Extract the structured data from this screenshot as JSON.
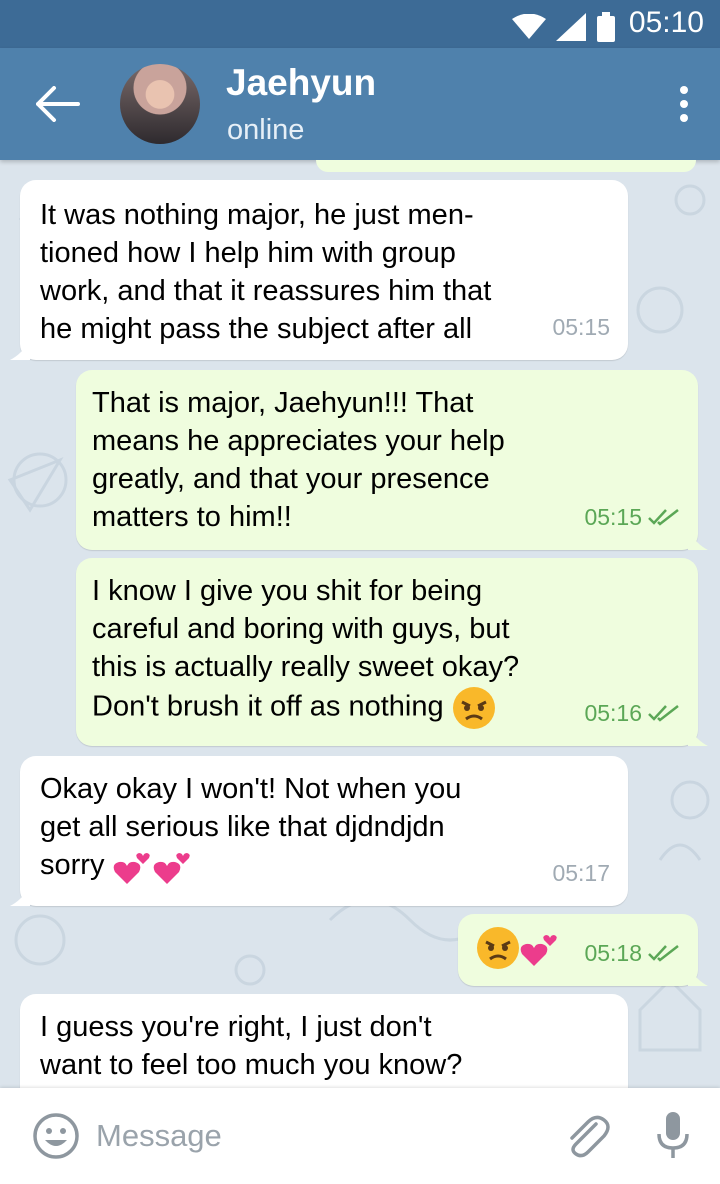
{
  "status_bar": {
    "time": "05:10"
  },
  "header": {
    "back_icon": "arrow-left-icon",
    "title": "Jaehyun",
    "status": "online",
    "menu_icon": "more-vert-icon"
  },
  "messages": [
    {
      "direction": "in",
      "text": "It was nothing major, he just men-\ntioned how I help him with group\nwork, and that it reassures him that\nhe might pass the subject after all",
      "time": "05:15"
    },
    {
      "direction": "out",
      "text": "That is major, Jaehyun!!! That\nmeans he appreciates your help\ngreatly, and that your presence\nmatters to him!!",
      "time": "05:15",
      "read": true
    },
    {
      "direction": "out",
      "text": "I know I give you shit for being\ncareful and boring with guys, but\nthis is actually really sweet okay?\nDon't brush it off as nothing",
      "emoji": [
        "angry-face"
      ],
      "time": "05:16",
      "read": true
    },
    {
      "direction": "in",
      "text": "Okay okay I won't! Not when you\nget all serious like that djdndjdn\nsorry",
      "emoji": [
        "two-hearts",
        "two-hearts"
      ],
      "time": "05:17"
    },
    {
      "direction": "out",
      "text": "",
      "emoji": [
        "angry-face",
        "two-hearts"
      ],
      "time": "05:18",
      "read": true
    },
    {
      "direction": "in",
      "text": "I guess you're right, I just don't\nwant to feel too much you know?"
    }
  ],
  "composer": {
    "placeholder": "Message",
    "emoji_icon": "smile-icon",
    "attach_icon": "paperclip-icon",
    "mic_icon": "microphone-icon"
  },
  "colors": {
    "header": "#4f81ac",
    "status_bar": "#3d6b96",
    "outgoing": "#effdde",
    "incoming": "#ffffff",
    "check": "#5ba756"
  }
}
